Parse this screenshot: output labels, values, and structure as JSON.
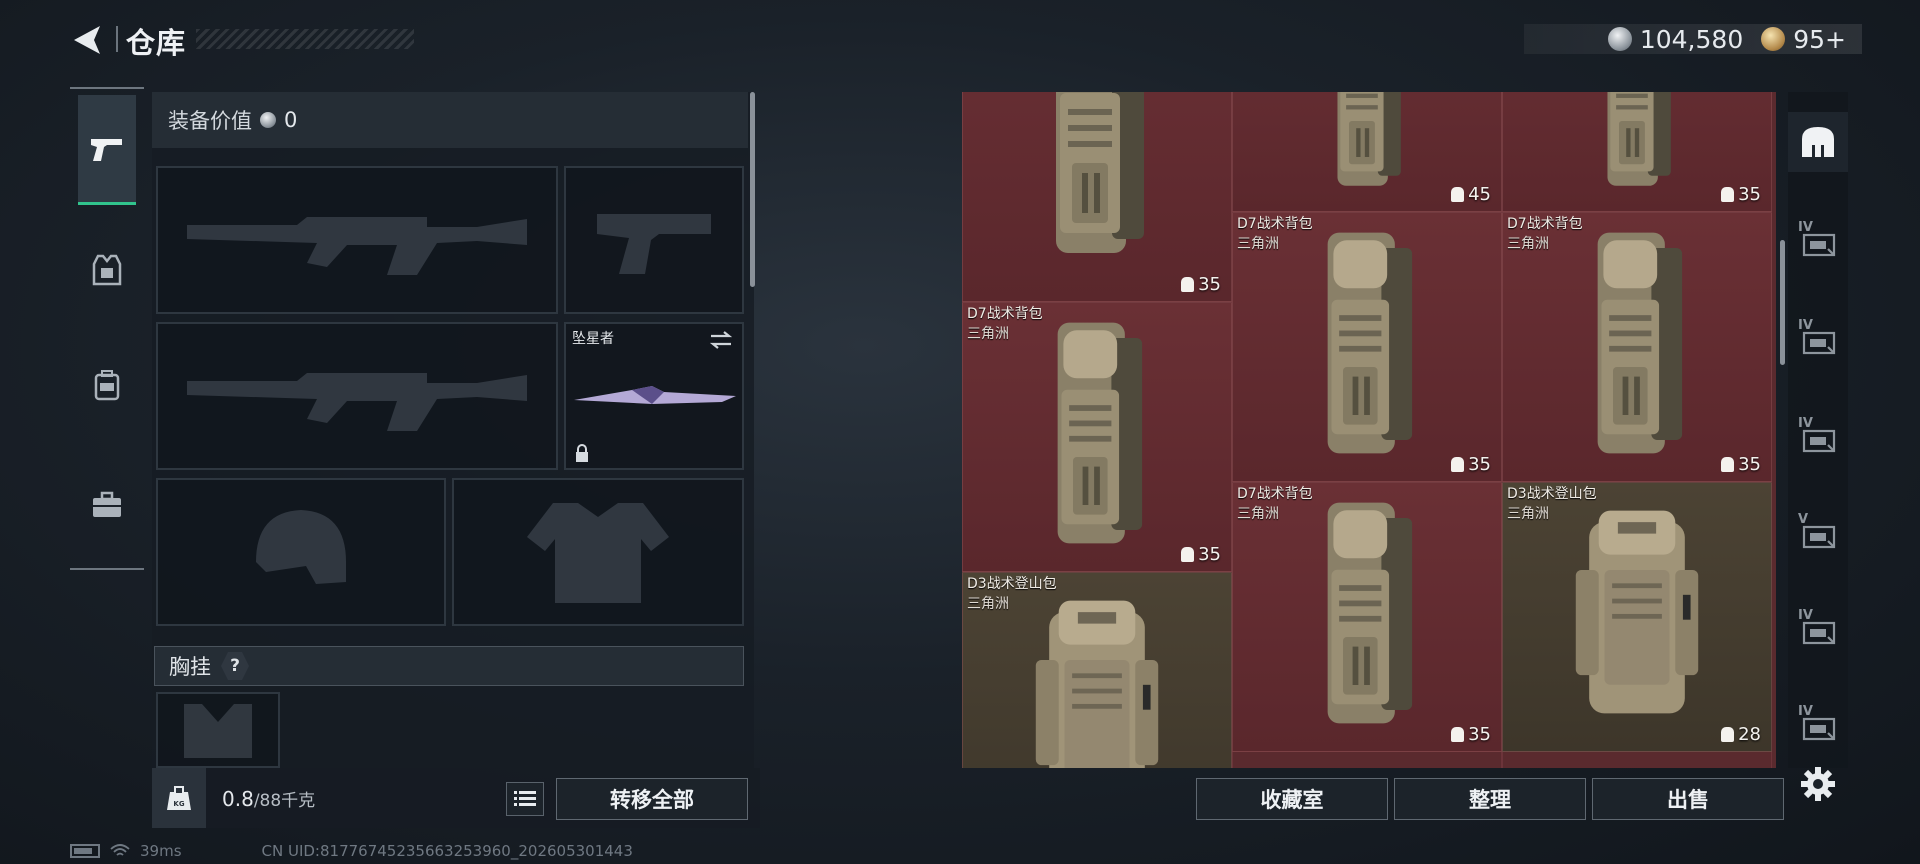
{
  "header": {
    "title": "仓库",
    "currency": [
      {
        "icon": "silver-coin-icon",
        "value": "104,580"
      },
      {
        "icon": "gold-coin-icon",
        "value": "95+"
      }
    ]
  },
  "left_tabs": [
    {
      "icon": "pistol-icon",
      "active": true
    },
    {
      "icon": "armor-vest-icon",
      "active": false
    },
    {
      "icon": "backpack-icon",
      "active": false
    },
    {
      "icon": "briefcase-icon",
      "active": false
    }
  ],
  "loadout": {
    "equip_value_label": "装备价值",
    "equip_value": "0",
    "melee_name": "坠星者",
    "chest_rig_label": "胸挂",
    "chest_rig_help": "?"
  },
  "weight": {
    "current": "0.8",
    "max": "/88千克"
  },
  "buttons": {
    "transfer_all": "转移全部",
    "collection": "收藏室",
    "organize": "整理",
    "sell": "出售"
  },
  "status": {
    "latency": "39ms",
    "uid": "CN UID:81776745235663253960_202605301443"
  },
  "inventory": {
    "items": [
      {
        "name": "",
        "sub": "",
        "capacity": "35",
        "type": "d7",
        "color": "maroon"
      },
      {
        "name": "",
        "sub": "",
        "capacity": "45",
        "type": "d7",
        "color": "maroon"
      },
      {
        "name": "",
        "sub": "",
        "capacity": "35",
        "type": "d7",
        "color": "maroon"
      },
      {
        "name": "D7战术背包",
        "sub": "三角洲",
        "capacity": "35",
        "type": "d7",
        "color": "maroon"
      },
      {
        "name": "D7战术背包",
        "sub": "三角洲",
        "capacity": "35",
        "type": "d7",
        "color": "maroon"
      },
      {
        "name": "D7战术背包",
        "sub": "三角洲",
        "capacity": "35",
        "type": "d7",
        "color": "maroon"
      },
      {
        "name": "D7战术背包",
        "sub": "三角洲",
        "capacity": "35",
        "type": "d7",
        "color": "maroon"
      },
      {
        "name": "D3战术登山包",
        "sub": "三角洲",
        "capacity": "28",
        "type": "d3",
        "color": "olive"
      },
      {
        "name": "D3战术登山包",
        "sub": "三角洲",
        "capacity": "",
        "type": "d3",
        "color": "olive"
      }
    ]
  },
  "right_categories": [
    {
      "icon": "warehouse-icon",
      "level": ""
    },
    {
      "icon": "gun-crate-icon",
      "level": "IV"
    },
    {
      "icon": "ammo-crate-icon",
      "level": "IV"
    },
    {
      "icon": "medical-crate-icon",
      "level": "IV"
    },
    {
      "icon": "safe-box-icon",
      "level": "V"
    },
    {
      "icon": "safe-box-2-icon",
      "level": "IV"
    },
    {
      "icon": "safe-box-3-icon",
      "level": "IV"
    }
  ]
}
